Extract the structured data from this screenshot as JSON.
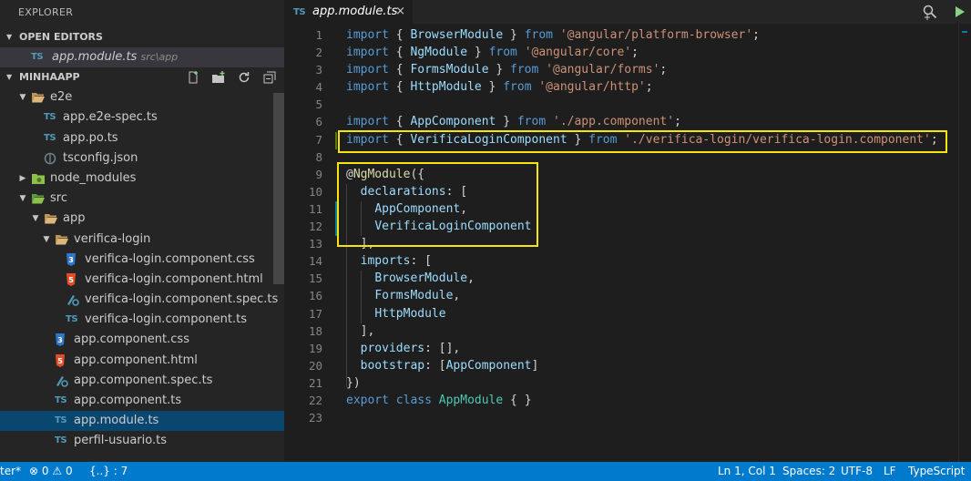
{
  "sidebar": {
    "title": "EXPLORER",
    "open_editors": {
      "header": "OPEN EDITORS",
      "items": [
        {
          "icon": "TS",
          "name": "app.module.ts",
          "path": "src\\app"
        }
      ]
    },
    "project": {
      "header": "MINHAAPP",
      "tree": [
        {
          "depth": 1,
          "type": "folder-open",
          "twisty": "▼",
          "name": "e2e"
        },
        {
          "depth": 2,
          "type": "ts",
          "name": "app.e2e-spec.ts"
        },
        {
          "depth": 2,
          "type": "ts",
          "name": "app.po.ts"
        },
        {
          "depth": 2,
          "type": "json",
          "name": "tsconfig.json"
        },
        {
          "depth": 1,
          "type": "folder-node",
          "twisty": "▶",
          "name": "node_modules"
        },
        {
          "depth": 1,
          "type": "folder-src",
          "twisty": "▼",
          "name": "src"
        },
        {
          "depth": 2,
          "type": "folder-open",
          "twisty": "▼",
          "name": "app"
        },
        {
          "depth": 3,
          "type": "folder-open",
          "twisty": "▼",
          "name": "verifica-login"
        },
        {
          "depth": 4,
          "type": "css",
          "name": "verifica-login.component.css"
        },
        {
          "depth": 4,
          "type": "html",
          "name": "verifica-login.component.html"
        },
        {
          "depth": 4,
          "type": "spec",
          "name": "verifica-login.component.spec.ts"
        },
        {
          "depth": 4,
          "type": "ts",
          "name": "verifica-login.component.ts"
        },
        {
          "depth": 3,
          "type": "css",
          "name": "app.component.css"
        },
        {
          "depth": 3,
          "type": "html",
          "name": "app.component.html"
        },
        {
          "depth": 3,
          "type": "spec",
          "name": "app.component.spec.ts"
        },
        {
          "depth": 3,
          "type": "ts",
          "name": "app.component.ts"
        },
        {
          "depth": 3,
          "type": "ts",
          "name": "app.module.ts",
          "selected": true
        },
        {
          "depth": 3,
          "type": "ts",
          "name": "perfil-usuario.ts"
        }
      ]
    }
  },
  "editor": {
    "tab": {
      "icon": "TS",
      "title": "app.module.ts",
      "close": "×"
    },
    "lines": [
      [
        [
          "kw",
          "import"
        ],
        [
          "pn",
          " { "
        ],
        [
          "id",
          "BrowserModule"
        ],
        [
          "pn",
          " } "
        ],
        [
          "kw",
          "from"
        ],
        [
          "pn",
          " "
        ],
        [
          "st",
          "'@angular/platform-browser'"
        ],
        [
          "pn",
          ";"
        ]
      ],
      [
        [
          "kw",
          "import"
        ],
        [
          "pn",
          " { "
        ],
        [
          "id",
          "NgModule"
        ],
        [
          "pn",
          " } "
        ],
        [
          "kw",
          "from"
        ],
        [
          "pn",
          " "
        ],
        [
          "st",
          "'@angular/core'"
        ],
        [
          "pn",
          ";"
        ]
      ],
      [
        [
          "kw",
          "import"
        ],
        [
          "pn",
          " { "
        ],
        [
          "id",
          "FormsModule"
        ],
        [
          "pn",
          " } "
        ],
        [
          "kw",
          "from"
        ],
        [
          "pn",
          " "
        ],
        [
          "st",
          "'@angular/forms'"
        ],
        [
          "pn",
          ";"
        ]
      ],
      [
        [
          "kw",
          "import"
        ],
        [
          "pn",
          " { "
        ],
        [
          "id",
          "HttpModule"
        ],
        [
          "pn",
          " } "
        ],
        [
          "kw",
          "from"
        ],
        [
          "pn",
          " "
        ],
        [
          "st",
          "'@angular/http'"
        ],
        [
          "pn",
          ";"
        ]
      ],
      [],
      [
        [
          "kw",
          "import"
        ],
        [
          "pn",
          " { "
        ],
        [
          "id",
          "AppComponent"
        ],
        [
          "pn",
          " } "
        ],
        [
          "kw",
          "from"
        ],
        [
          "pn",
          " "
        ],
        [
          "st",
          "'./app.component'"
        ],
        [
          "pn",
          ";"
        ]
      ],
      [
        [
          "kw",
          "import"
        ],
        [
          "pn",
          " { "
        ],
        [
          "id",
          "VerificaLoginComponent"
        ],
        [
          "pn",
          " } "
        ],
        [
          "kw",
          "from"
        ],
        [
          "pn",
          " "
        ],
        [
          "st",
          "'./verifica-login/verifica-login.component'"
        ],
        [
          "pn",
          ";"
        ]
      ],
      [],
      [
        [
          "pn",
          "@"
        ],
        [
          "dc",
          "NgModule"
        ],
        [
          "pn",
          "({"
        ]
      ],
      [
        [
          "pn",
          "  "
        ],
        [
          "id",
          "declarations"
        ],
        [
          "pn",
          ": ["
        ]
      ],
      [
        [
          "pn",
          "    "
        ],
        [
          "id",
          "AppComponent"
        ],
        [
          "pn",
          ","
        ]
      ],
      [
        [
          "pn",
          "    "
        ],
        [
          "id",
          "VerificaLoginComponent"
        ]
      ],
      [
        [
          "pn",
          "  ],"
        ]
      ],
      [
        [
          "pn",
          "  "
        ],
        [
          "id",
          "imports"
        ],
        [
          "pn",
          ": ["
        ]
      ],
      [
        [
          "pn",
          "    "
        ],
        [
          "id",
          "BrowserModule"
        ],
        [
          "pn",
          ","
        ]
      ],
      [
        [
          "pn",
          "    "
        ],
        [
          "id",
          "FormsModule"
        ],
        [
          "pn",
          ","
        ]
      ],
      [
        [
          "pn",
          "    "
        ],
        [
          "id",
          "HttpModule"
        ]
      ],
      [
        [
          "pn",
          "  ],"
        ]
      ],
      [
        [
          "pn",
          "  "
        ],
        [
          "id",
          "providers"
        ],
        [
          "pn",
          ": [],"
        ]
      ],
      [
        [
          "pn",
          "  "
        ],
        [
          "id",
          "bootstrap"
        ],
        [
          "pn",
          ": ["
        ],
        [
          "id",
          "AppComponent"
        ],
        [
          "pn",
          "]"
        ]
      ],
      [
        [
          "pn",
          "})"
        ]
      ],
      [
        [
          "kw",
          "export"
        ],
        [
          "pn",
          " "
        ],
        [
          "kw",
          "class"
        ],
        [
          "pn",
          " "
        ],
        [
          "cls",
          "AppModule"
        ],
        [
          "pn",
          " { }"
        ]
      ],
      []
    ]
  },
  "statusbar": {
    "branch": "ter*",
    "errors": "0",
    "warnings": "0",
    "json_info": "{..} : 7",
    "position": "Ln 1, Col 1",
    "spaces": "Spaces: 2",
    "encoding": "UTF-8",
    "eol": "LF",
    "language": "TypeScript"
  },
  "colors": {
    "highlight": "#f5e50a",
    "ts": "#519aba",
    "status": "#007acc",
    "selected": "#094771"
  }
}
